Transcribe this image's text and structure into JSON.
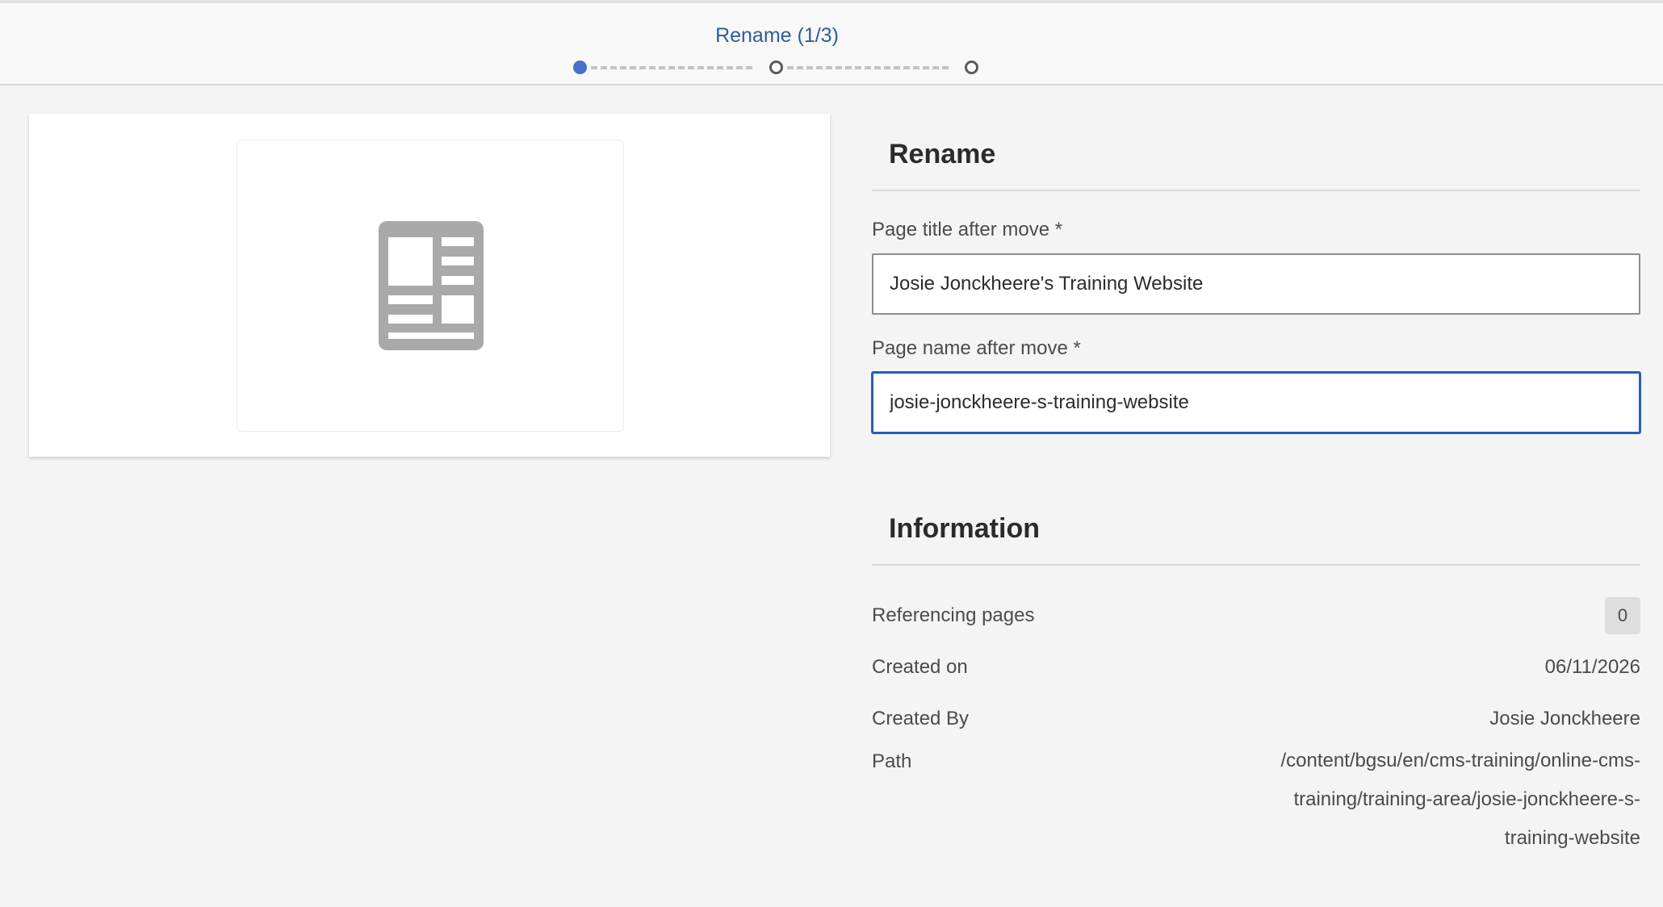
{
  "wizard": {
    "step_title": "Rename (1/3)",
    "steps": 3,
    "current_step": 1
  },
  "preview": {
    "icon": "page-thumbnail-icon"
  },
  "rename": {
    "heading": "Rename",
    "title_label": "Page title after move *",
    "title_value": "Josie Jonckheere's Training Website",
    "name_label": "Page name after move *",
    "name_value": "josie-jonckheere-s-training-website"
  },
  "information": {
    "heading": "Information",
    "referencing_label": "Referencing pages",
    "referencing_count": "0",
    "created_on_label": "Created on",
    "created_on_value": "06/11/2026",
    "created_by_label": "Created By",
    "created_by_value": "Josie Jonckheere",
    "path_label": "Path",
    "path_value": "/content/bgsu/en/cms-training/online-cms-training/training-area/josie-jonckheere-s-training-website"
  },
  "colors": {
    "accent": "#2d5d98",
    "active_step": "#4a6fc9",
    "focus": "#2a5db7"
  }
}
